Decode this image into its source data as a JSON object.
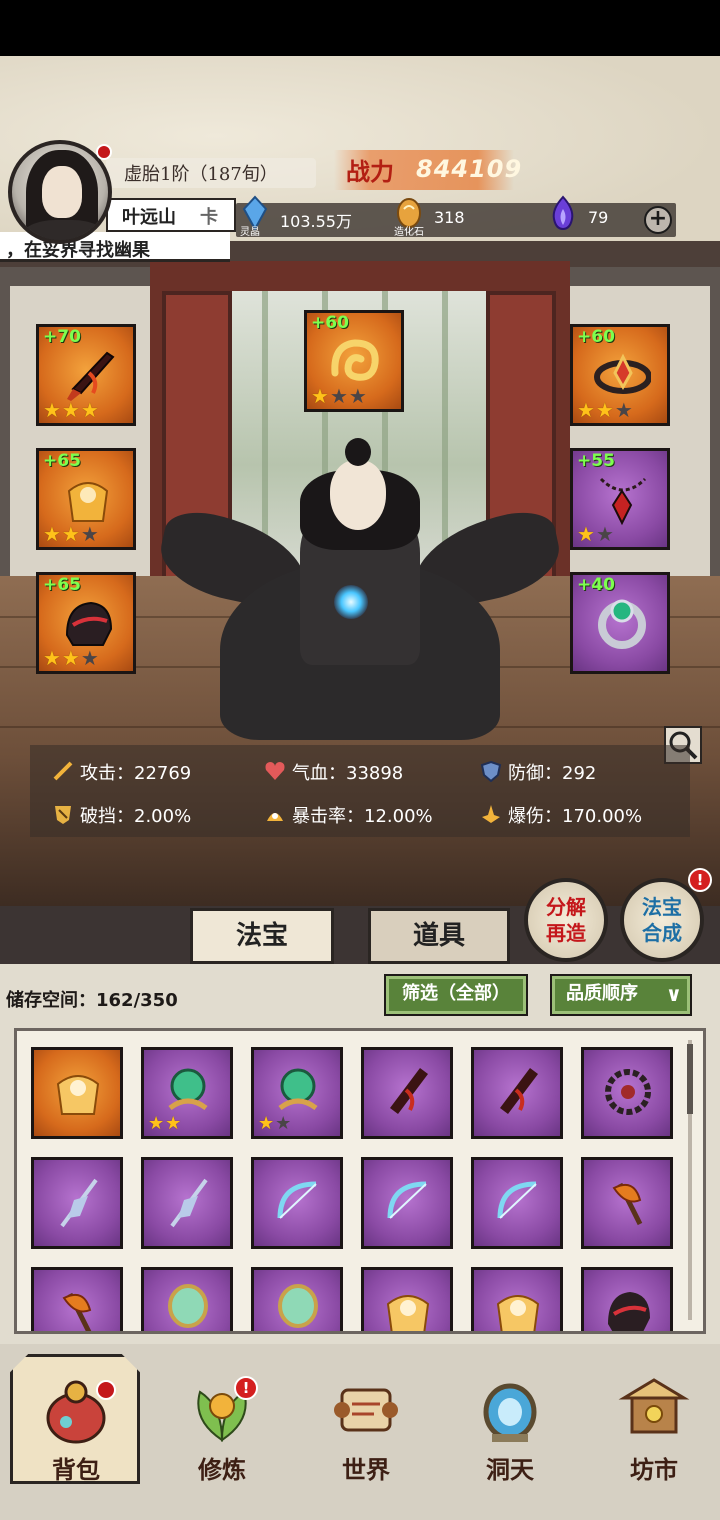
{
  "header": {
    "realm": "虚胎1阶（187旬）",
    "player_name": "叶远山",
    "name_suffix": "卡",
    "power_label": "战力",
    "power_value": "844109",
    "quest_text": "，在妥界寻找幽果",
    "resources": [
      {
        "name": "灵晶",
        "value": "103.55万",
        "icon": "crystal-icon",
        "color": "#5aa6e8"
      },
      {
        "name": "造化石",
        "value": "318",
        "icon": "creation-stone-icon",
        "color": "#e7a33d"
      },
      {
        "name": "",
        "value": "79",
        "icon": "purple-flame-icon",
        "color": "#6a3fd8"
      }
    ]
  },
  "equipment_slots": [
    {
      "bonus": "+70",
      "rarity": "orange",
      "stars": 3,
      "icon": "dagger-icon"
    },
    {
      "bonus": "+60",
      "rarity": "orange",
      "stars": 1,
      "icon": "golden-swirl-icon"
    },
    {
      "bonus": "+60",
      "rarity": "orange",
      "stars": 2,
      "icon": "crown-ring-icon"
    },
    {
      "bonus": "+65",
      "rarity": "orange",
      "stars": 2,
      "icon": "lotus-armor-icon"
    },
    {
      "bonus": "+55",
      "rarity": "purple",
      "stars": 1,
      "icon": "pendant-icon"
    },
    {
      "bonus": "+65",
      "rarity": "orange",
      "stars": 2,
      "icon": "helmet-icon"
    },
    {
      "bonus": "+40",
      "rarity": "purple",
      "stars": 0,
      "icon": "jade-ring-icon"
    }
  ],
  "stats": [
    {
      "label": "攻击：22769",
      "icon": "sword-stat-icon"
    },
    {
      "label": "气血：33898",
      "icon": "heart-stat-icon"
    },
    {
      "label": "防御：292",
      "icon": "shield-stat-icon"
    },
    {
      "label": "破挡：2.00%",
      "icon": "break-stat-icon"
    },
    {
      "label": "暴击率：12.00%",
      "icon": "crit-rate-stat-icon"
    },
    {
      "label": "爆伤：170.00%",
      "icon": "crit-damage-stat-icon"
    }
  ],
  "actions": {
    "decompose": {
      "line1": "分解",
      "line2": "再造"
    },
    "synthesize": {
      "line1": "法宝",
      "line2": "合成",
      "badge": "!"
    }
  },
  "tabs": {
    "artifact": "法宝",
    "items": "道具"
  },
  "bag": {
    "storage_label": "储存空间：",
    "storage_value": "162/350",
    "filter_label": "筛选（全部）",
    "sort_label": "品质顺序"
  },
  "inventory": [
    {
      "rarity": "orange",
      "stars": 0,
      "icon": "lotus-armor-icon"
    },
    {
      "rarity": "purple",
      "stars": 2,
      "icon": "jade-emblem-icon"
    },
    {
      "rarity": "purple",
      "stars": 1,
      "icon": "jade-emblem-icon"
    },
    {
      "rarity": "purple",
      "stars": 0,
      "icon": "dagger-icon"
    },
    {
      "rarity": "purple",
      "stars": 0,
      "icon": "dagger-icon"
    },
    {
      "rarity": "purple",
      "stars": 0,
      "icon": "spiked-wheel-icon"
    },
    {
      "rarity": "purple",
      "stars": 0,
      "icon": "flag-spear-icon"
    },
    {
      "rarity": "purple",
      "stars": 0,
      "icon": "flag-spear-icon"
    },
    {
      "rarity": "purple",
      "stars": 0,
      "icon": "ice-bow-icon"
    },
    {
      "rarity": "purple",
      "stars": 0,
      "icon": "ice-bow-icon"
    },
    {
      "rarity": "purple",
      "stars": 0,
      "icon": "ice-bow-icon"
    },
    {
      "rarity": "purple",
      "stars": 0,
      "icon": "flame-axe-icon"
    },
    {
      "rarity": "purple",
      "stars": 0,
      "icon": "flame-axe-icon"
    },
    {
      "rarity": "purple",
      "stars": 0,
      "icon": "jade-mirror-icon"
    },
    {
      "rarity": "purple",
      "stars": 0,
      "icon": "jade-mirror-icon"
    },
    {
      "rarity": "purple",
      "stars": 0,
      "icon": "lotus-armor-icon"
    },
    {
      "rarity": "purple",
      "stars": 0,
      "icon": "lotus-armor-icon"
    },
    {
      "rarity": "purple",
      "stars": 0,
      "icon": "helmet-icon"
    }
  ],
  "nav": [
    {
      "label": "背包",
      "icon": "bag-icon",
      "active": true,
      "badge": "dot"
    },
    {
      "label": "修炼",
      "icon": "cultivate-icon",
      "active": false,
      "badge": "!"
    },
    {
      "label": "世界",
      "icon": "world-scroll-icon",
      "active": false,
      "badge": ""
    },
    {
      "label": "洞天",
      "icon": "grotto-portal-icon",
      "active": false,
      "badge": ""
    },
    {
      "label": "坊市",
      "icon": "market-icon",
      "active": false,
      "badge": ""
    }
  ],
  "colors": {
    "orange_quality": "#d66a1c",
    "purple_quality": "#8a4aa4",
    "bonus_green": "#7dff4f",
    "star_gold": "#ffc21a",
    "filter_green": "#59833a"
  }
}
